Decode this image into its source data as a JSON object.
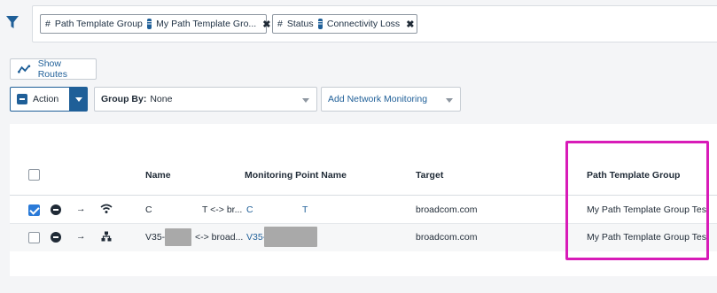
{
  "filter_bar": {
    "chips": [
      {
        "field": "Path Template Group",
        "value": "My Path Template Gro...",
        "operator": "="
      },
      {
        "field": "Status",
        "value": "Connectivity Loss",
        "operator": "="
      }
    ],
    "hash": "#",
    "remove_glyph": "✖"
  },
  "toolbar": {
    "show_routes_label": "Show Routes",
    "action_label": "Action",
    "group_by_label": "Group By:",
    "group_by_value": "None",
    "network_monitoring_label": "Add Network Monitoring"
  },
  "table": {
    "columns": [
      "Name",
      "Monitoring Point Name",
      "Target",
      "Path Template Group"
    ],
    "rows": [
      {
        "checked": true,
        "status_icon": "minus-circle-icon",
        "arrow": "→",
        "type_icon": "wifi-icon",
        "name_prefix": "C",
        "name_suffix": "T <-> br...",
        "monitoring_point_prefix": "C",
        "monitoring_point_suffix": "T",
        "target": "broadcom.com",
        "path_template_group": "My Path Template Group Test"
      },
      {
        "checked": false,
        "status_icon": "minus-circle-icon",
        "arrow": "→",
        "type_icon": "network-icon",
        "name_prefix": "V35-",
        "name_suffix": "<-> broad...",
        "monitoring_point_prefix": "V35-",
        "monitoring_point_suffix": "",
        "target": "broadcom.com",
        "path_template_group": "My Path Template Group Test"
      }
    ]
  },
  "colors": {
    "accent": "#1f5f98",
    "highlight": "#d81bb8",
    "checkbox_checked": "#2a7ad8"
  }
}
